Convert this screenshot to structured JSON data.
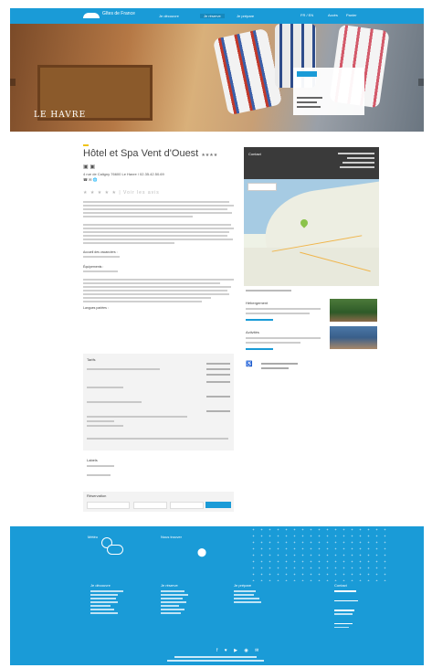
{
  "header": {
    "logo_text": "Gîtes de France",
    "nav": [
      "Je découvre",
      "Je réserve",
      "Je prépare"
    ],
    "utility": [
      "FR / EN",
      "Accès",
      "Panier"
    ]
  },
  "hero": {
    "title": "LE HAVRE"
  },
  "listing": {
    "name": "Hôtel et Spa Vent d'Ouest",
    "stars": "★★★★",
    "address": "4 rue de Caligny  76600 Le Havre  / 02.35.42.50.69",
    "phone": "☎  ✉  🌐",
    "rating": "★ ★ ★ ★ ★  |  Voir les avis",
    "label_arrival": "Accueil des vacanciers :",
    "label_facilities": "Équipements :",
    "label_services": "Services :",
    "label_lang": "Langues parlées :"
  },
  "contact": {
    "label": "Contact"
  },
  "map": {
    "link": "Agrandir le plan"
  },
  "promos": [
    {
      "title": "Hébergement"
    },
    {
      "title": "Activités"
    }
  ],
  "access": {
    "icon": "wheelchair-icon"
  },
  "tarifs": {
    "title": "Tarifs"
  },
  "sections": {
    "labels_title": "Labels",
    "payment_title": "Modes de paiement"
  },
  "booking": {
    "title": "Réservation"
  },
  "footer": {
    "weather_title": "Météo",
    "map_title": "Nous trouver",
    "columns": [
      "Je découvre",
      "Je réserve",
      "Je prépare",
      "Contact"
    ]
  },
  "colors": {
    "brand": "#1a9bd7",
    "dark": "#3a3a3a"
  }
}
